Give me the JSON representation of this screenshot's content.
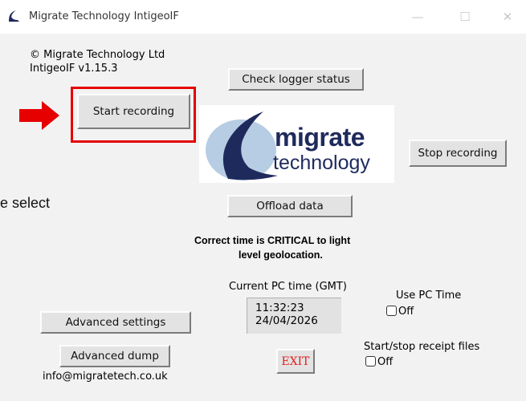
{
  "window": {
    "title": "Migrate Technology IntigeoIF",
    "minimize_glyph": "—",
    "maximize_glyph": "☐",
    "close_glyph": "✕"
  },
  "header": {
    "copyright": "© Migrate Technology Ltd",
    "version": "IntigeoIF v1.15.3"
  },
  "buttons": {
    "check_logger_status": "Check logger status",
    "start_recording": "Start recording",
    "stop_recording": "Stop recording",
    "offload_data": "Offload data",
    "advanced_settings": "Advanced settings",
    "advanced_dump": "Advanced dump",
    "exit": "EXIT"
  },
  "logo": {
    "word1": "migrate",
    "word2": "technology"
  },
  "overlay_text": "e select",
  "notice": {
    "line1": "Correct time is CRITICAL to light",
    "line2": "level geolocation."
  },
  "time": {
    "label": "Current PC time (GMT)",
    "clock": "11:32:23",
    "date": "24/04/2026"
  },
  "use_pc_time": {
    "label": "Use PC Time",
    "value": "Off",
    "checked": false
  },
  "receipt_files": {
    "label": "Start/stop receipt files",
    "value": "Off",
    "checked": false
  },
  "contact_email": "info@migratetech.co.uk",
  "colors": {
    "highlight": "#e60000",
    "logo_navy": "#1f2a5c",
    "logo_light_blue": "#b7cde3",
    "exit_red": "#e02020"
  },
  "icons": {
    "app": "bird-silhouette-icon",
    "annotation": "red-arrow-icon"
  }
}
